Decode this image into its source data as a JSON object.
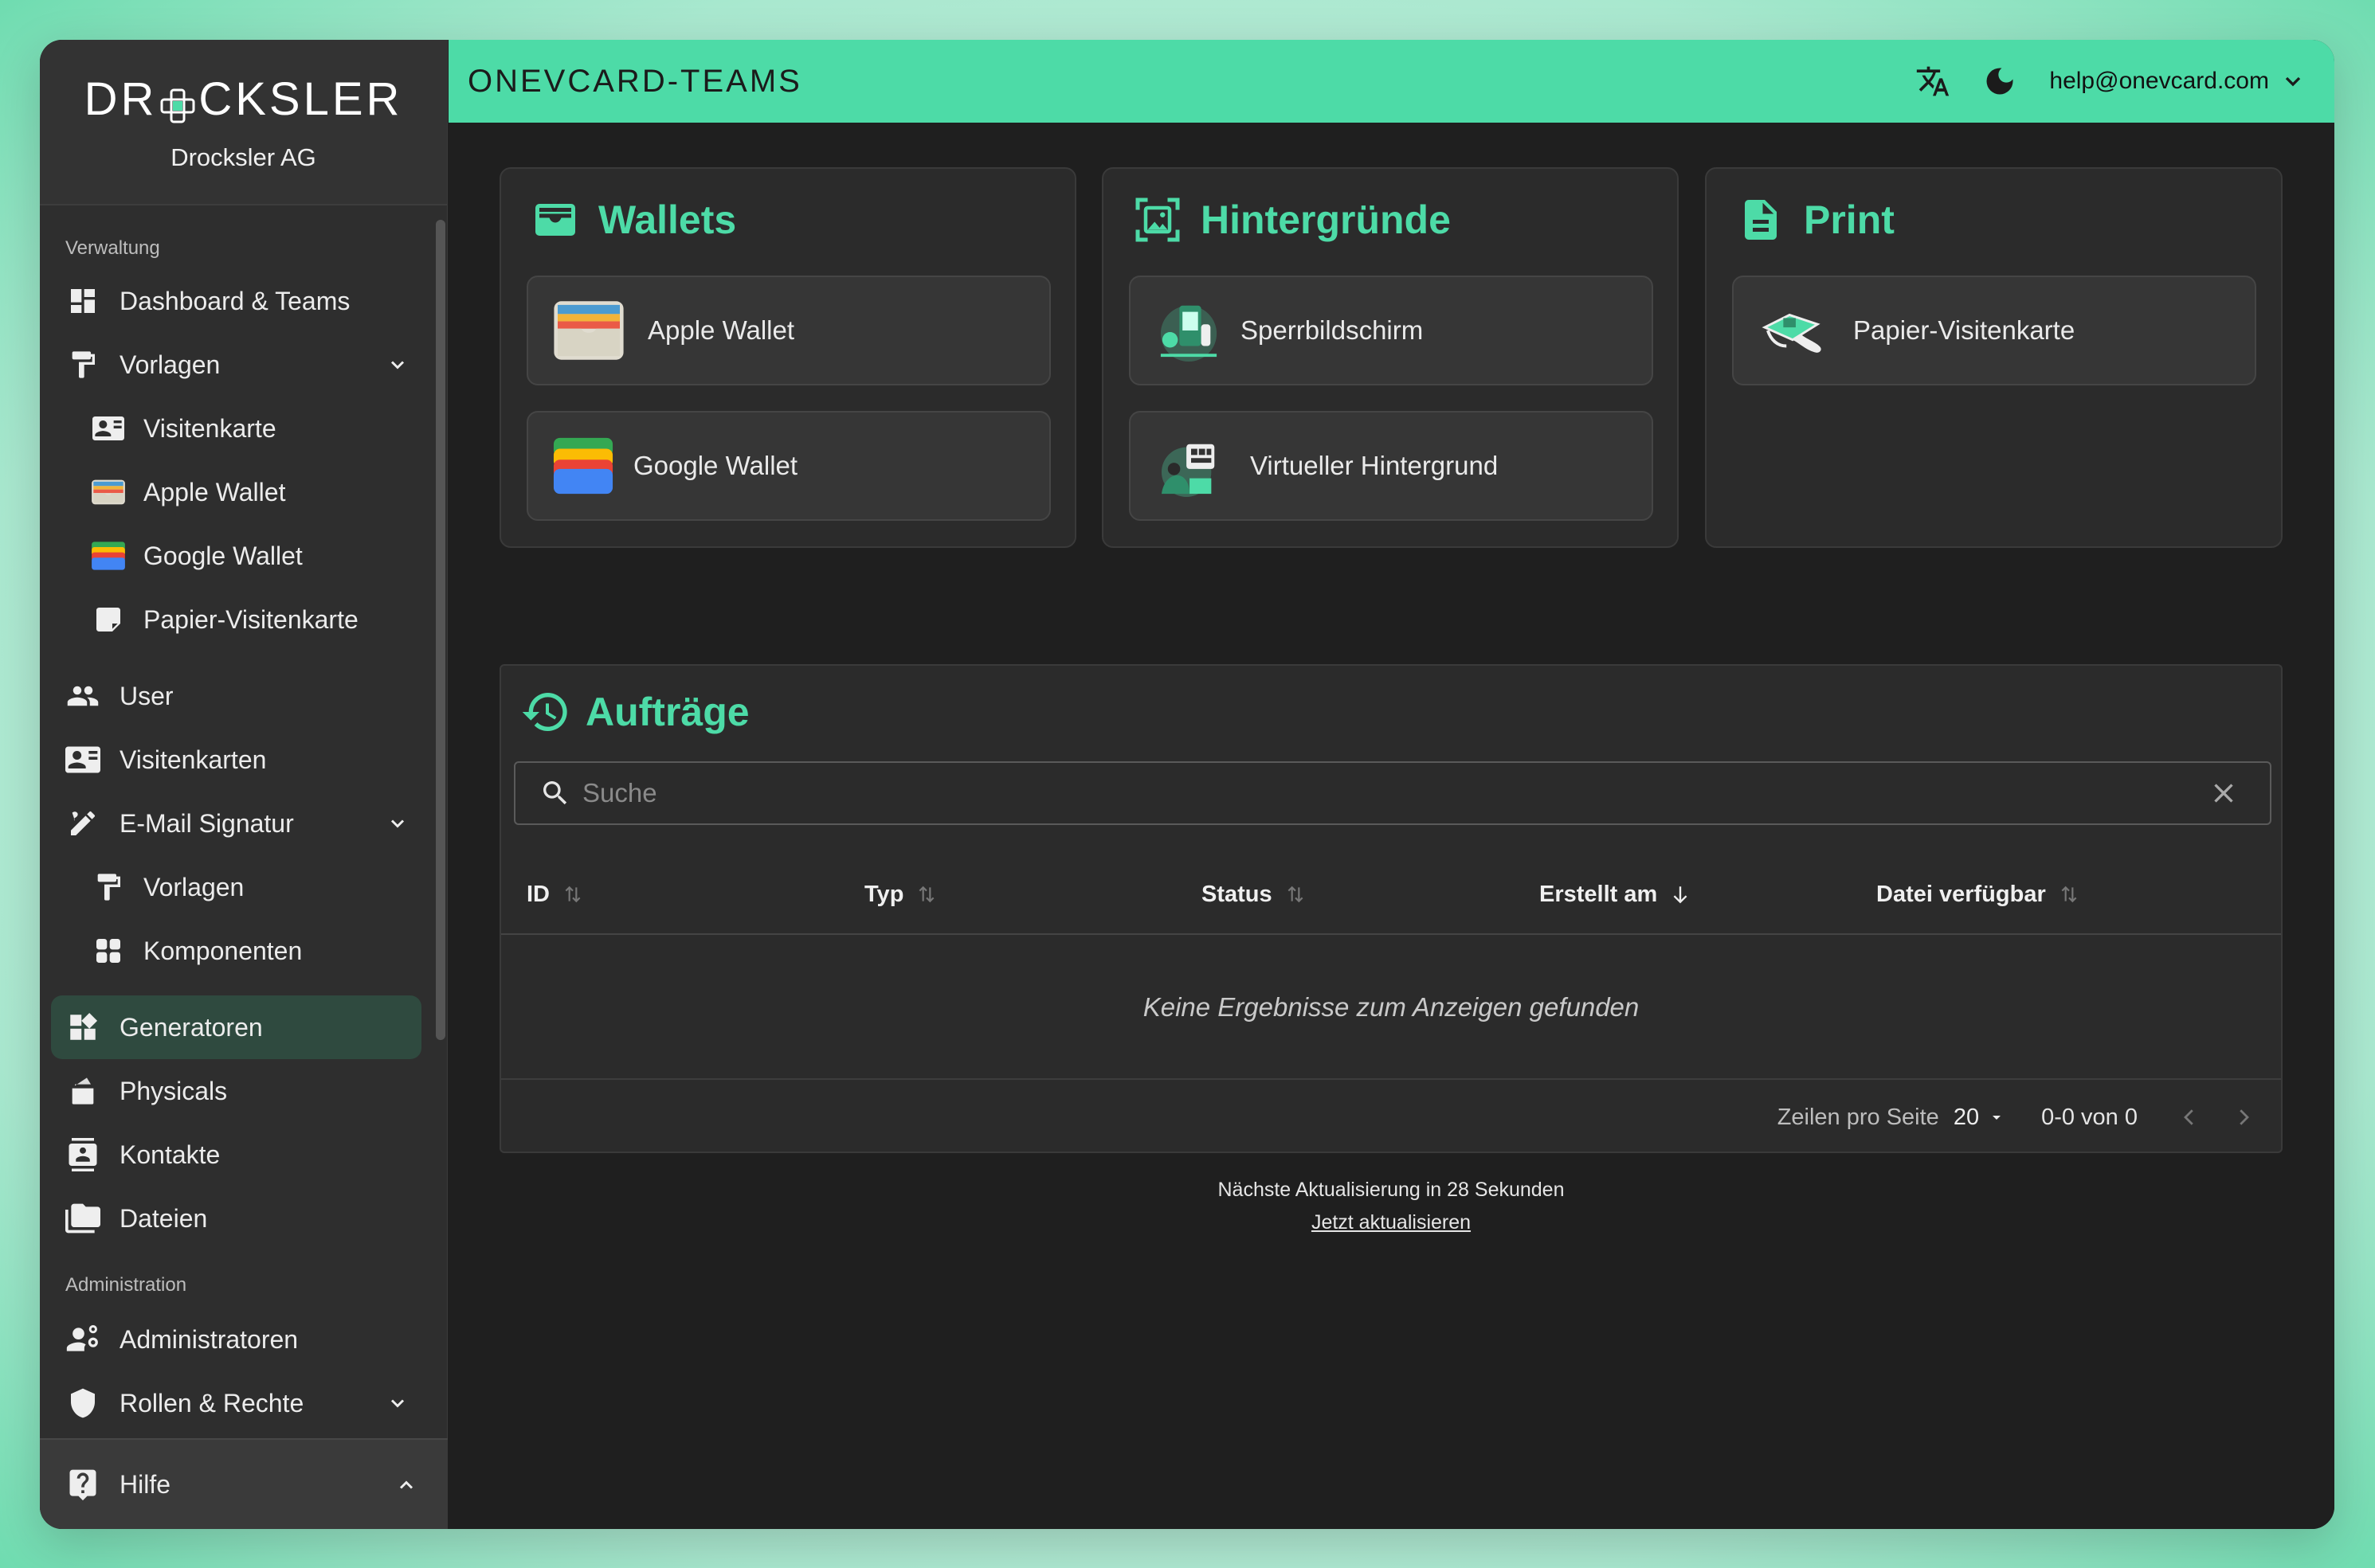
{
  "brand": {
    "logo": "DROCKSLER",
    "logo_left": "DR",
    "logo_right": "CKSLER",
    "company": "Drocksler AG"
  },
  "sidebar": {
    "section_1": "Verwaltung",
    "section_2": "Administration",
    "items": {
      "dashboard": "Dashboard & Teams",
      "vorlagen": "Vorlagen",
      "visitenkarte": "Visitenkarte",
      "apple_wallet": "Apple Wallet",
      "google_wallet": "Google Wallet",
      "papier": "Papier-Visitenkarte",
      "user": "User",
      "visitenkarten": "Visitenkarten",
      "email_signatur": "E-Mail Signatur",
      "sig_vorlagen": "Vorlagen",
      "komponenten": "Komponenten",
      "generatoren": "Generatoren",
      "physicals": "Physicals",
      "kontakte": "Kontakte",
      "dateien": "Dateien",
      "administratoren": "Administratoren",
      "rollen": "Rollen & Rechte"
    },
    "help": "Hilfe"
  },
  "topbar": {
    "title": "ONEVCARD-TEAMS",
    "email": "help@onevcard.com"
  },
  "cards": {
    "wallets": {
      "title": "Wallets",
      "tiles": [
        "Apple Wallet",
        "Google Wallet"
      ]
    },
    "hintergruende": {
      "title": "Hintergründe",
      "tiles": [
        "Sperrbildschirm",
        "Virtueller Hintergrund"
      ]
    },
    "print": {
      "title": "Print",
      "tiles": [
        "Papier-Visitenkarte"
      ]
    }
  },
  "orders": {
    "title": "Aufträge",
    "search_placeholder": "Suche",
    "columns": [
      "ID",
      "Typ",
      "Status",
      "Erstellt am",
      "Datei verfügbar"
    ],
    "empty": "Keine Ergebnisse zum Anzeigen gefunden",
    "rows_per_page_label": "Zeilen pro Seite",
    "rows_per_page": "20",
    "range": "0-0 von 0"
  },
  "refresh": {
    "text": "Nächste Aktualisierung in 28 Sekunden",
    "link": "Jetzt aktualisieren"
  },
  "colors": {
    "accent": "#4ddba7",
    "sidebar": "#2e2e2e",
    "main": "#1f1f1f",
    "card": "#2b2b2b"
  }
}
